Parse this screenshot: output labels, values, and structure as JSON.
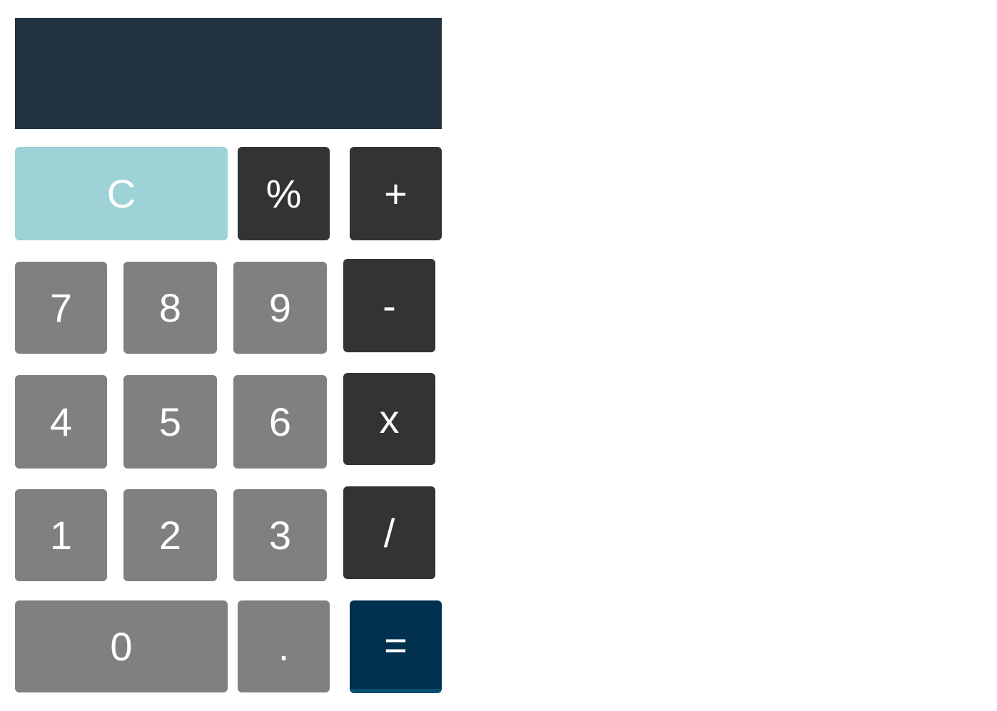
{
  "display": {
    "value": ""
  },
  "keys": {
    "clear": "C",
    "percent": "%",
    "plus": "+",
    "seven": "7",
    "eight": "8",
    "nine": "9",
    "minus": "-",
    "four": "4",
    "five": "5",
    "six": "6",
    "multiply": "x",
    "one": "1",
    "two": "2",
    "three": "3",
    "divide": "/",
    "zero": "0",
    "decimal": ".",
    "equals": "="
  },
  "colors": {
    "display_bg": "#223240",
    "clear_bg": "#9dd2d6",
    "operator_bg": "#333333",
    "number_bg": "#808080",
    "equals_bg": "#00324f",
    "key_text": "#ffffff"
  }
}
